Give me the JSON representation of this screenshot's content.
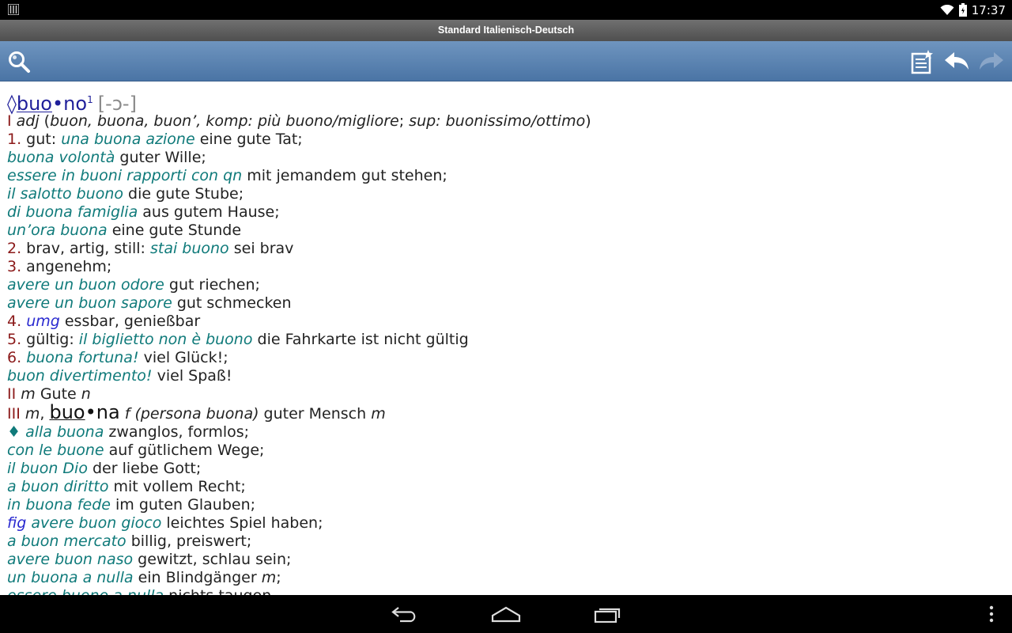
{
  "status": {
    "time": "17:37"
  },
  "app": {
    "title": "Standard Italienisch-Deutsch"
  },
  "icons": {
    "search": "search-icon",
    "favorites": "bookmark-list-icon",
    "back": "back-arrow-icon",
    "forward": "forward-arrow-icon",
    "nav_back": "nav-back-icon",
    "nav_home": "nav-home-icon",
    "nav_recent": "nav-recents-icon",
    "menu": "overflow-menu-icon"
  },
  "colors": {
    "toolbar": "#5a82b2",
    "example": "#0f7a7a",
    "sense_number": "#8b1a1a",
    "register": "#2a2ad0",
    "headword": "#1f1f9a"
  },
  "entry": {
    "mark": "◊",
    "headword_syl": [
      "buo",
      "no"
    ],
    "headword_sup": "1",
    "pronunciation": "[-ɔ-]",
    "lines": [
      [
        {
          "t": "roman",
          "v": "I"
        },
        {
          "t": "text",
          "v": " "
        },
        {
          "t": "gram",
          "v": "adj"
        },
        {
          "t": "text",
          "v": " ("
        },
        {
          "t": "gram",
          "v": "buon, buona, buon’, komp: più buono/migliore"
        },
        {
          "t": "text",
          "v": "; "
        },
        {
          "t": "gram",
          "v": "sup: buonissimo/ottimo"
        },
        {
          "t": "text",
          "v": ")"
        }
      ],
      [
        {
          "t": "num",
          "v": "1."
        },
        {
          "t": "text",
          "v": " gut: "
        },
        {
          "t": "ex",
          "v": "una buona azione"
        },
        {
          "t": "text",
          "v": " eine gute Tat;"
        }
      ],
      [
        {
          "t": "ex",
          "v": "buona volontà"
        },
        {
          "t": "text",
          "v": " guter Wille;"
        }
      ],
      [
        {
          "t": "ex",
          "v": "essere in buoni rapporti con qn"
        },
        {
          "t": "text",
          "v": " mit jemandem gut stehen;"
        }
      ],
      [
        {
          "t": "ex",
          "v": "il salotto buono"
        },
        {
          "t": "text",
          "v": " die gute Stube;"
        }
      ],
      [
        {
          "t": "ex",
          "v": "di buona famiglia"
        },
        {
          "t": "text",
          "v": " aus gutem Hause;"
        }
      ],
      [
        {
          "t": "ex",
          "v": "un’ora buona"
        },
        {
          "t": "text",
          "v": " eine gute Stunde"
        }
      ],
      [
        {
          "t": "num",
          "v": "2."
        },
        {
          "t": "text",
          "v": " brav, artig, still: "
        },
        {
          "t": "ex",
          "v": "stai buono"
        },
        {
          "t": "text",
          "v": " sei brav"
        }
      ],
      [
        {
          "t": "num",
          "v": "3."
        },
        {
          "t": "text",
          "v": " angenehm;"
        }
      ],
      [
        {
          "t": "ex",
          "v": "avere un buon odore"
        },
        {
          "t": "text",
          "v": " gut riechen;"
        }
      ],
      [
        {
          "t": "ex",
          "v": "avere un buon sapore"
        },
        {
          "t": "text",
          "v": " gut schmecken"
        }
      ],
      [
        {
          "t": "num",
          "v": "4."
        },
        {
          "t": "text",
          "v": " "
        },
        {
          "t": "reg",
          "v": "umg"
        },
        {
          "t": "text",
          "v": " essbar, genießbar"
        }
      ],
      [
        {
          "t": "num",
          "v": "5."
        },
        {
          "t": "text",
          "v": " gültig: "
        },
        {
          "t": "ex",
          "v": "il biglietto non è buono"
        },
        {
          "t": "text",
          "v": " die Fahrkarte ist nicht gültig"
        }
      ],
      [
        {
          "t": "num",
          "v": "6."
        },
        {
          "t": "text",
          "v": " "
        },
        {
          "t": "ex",
          "v": "buona fortuna!"
        },
        {
          "t": "text",
          "v": " viel Glück!;"
        }
      ],
      [
        {
          "t": "ex",
          "v": "buon divertimento!"
        },
        {
          "t": "text",
          "v": " viel Spaß!"
        }
      ],
      [
        {
          "t": "roman",
          "v": "II"
        },
        {
          "t": "text",
          "v": " "
        },
        {
          "t": "gram",
          "v": "m"
        },
        {
          "t": "text",
          "v": " Gute "
        },
        {
          "t": "gram",
          "v": "n"
        }
      ],
      [
        {
          "t": "roman",
          "v": "III"
        },
        {
          "t": "text",
          "v": " "
        },
        {
          "t": "gram",
          "v": "m"
        },
        {
          "t": "text",
          "v": ", "
        },
        {
          "t": "sub",
          "v": "buo•na"
        },
        {
          "t": "text",
          "v": " "
        },
        {
          "t": "gram",
          "v": "f (persona buona)"
        },
        {
          "t": "text",
          "v": " guter Mensch "
        },
        {
          "t": "gram",
          "v": "m"
        }
      ],
      [
        {
          "t": "ex",
          "v": "♦ alla buona"
        },
        {
          "t": "text",
          "v": " zwanglos, formlos;"
        }
      ],
      [
        {
          "t": "ex",
          "v": "con le buone"
        },
        {
          "t": "text",
          "v": " auf gütlichem Wege;"
        }
      ],
      [
        {
          "t": "ex",
          "v": "il buon Dio"
        },
        {
          "t": "text",
          "v": " der liebe Gott;"
        }
      ],
      [
        {
          "t": "ex",
          "v": "a buon diritto"
        },
        {
          "t": "text",
          "v": " mit vollem Recht;"
        }
      ],
      [
        {
          "t": "ex",
          "v": "in buona fede"
        },
        {
          "t": "text",
          "v": " im guten Glauben;"
        }
      ],
      [
        {
          "t": "reg",
          "v": "fig"
        },
        {
          "t": "text",
          "v": " "
        },
        {
          "t": "ex",
          "v": "avere buon gioco"
        },
        {
          "t": "text",
          "v": " leichtes Spiel haben;"
        }
      ],
      [
        {
          "t": "ex",
          "v": "a buon mercato"
        },
        {
          "t": "text",
          "v": " billig, preiswert;"
        }
      ],
      [
        {
          "t": "ex",
          "v": "avere buon naso"
        },
        {
          "t": "text",
          "v": " gewitzt, schlau sein;"
        }
      ],
      [
        {
          "t": "ex",
          "v": "un buona a nulla"
        },
        {
          "t": "text",
          "v": " ein Blindgänger "
        },
        {
          "t": "gram",
          "v": "m"
        },
        {
          "t": "text",
          "v": ";"
        }
      ],
      [
        {
          "t": "ex",
          "v": "essere buono a nulla"
        },
        {
          "t": "text",
          "v": " nichts taugen"
        }
      ]
    ]
  }
}
